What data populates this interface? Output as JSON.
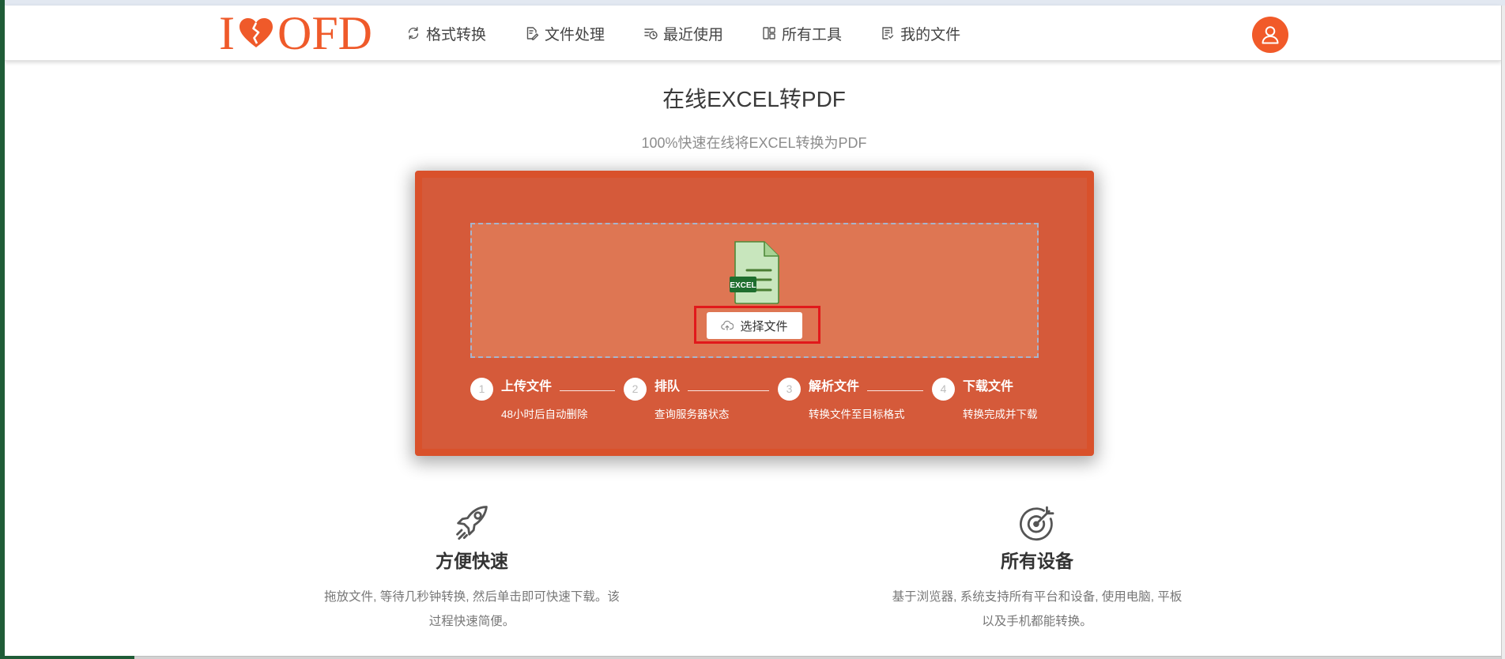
{
  "header": {
    "logo": {
      "text_left": "I",
      "text_right": "OFD",
      "icon": "broken-heart-icon"
    },
    "nav": [
      {
        "label": "格式转换",
        "icon": "convert-icon"
      },
      {
        "label": "文件处理",
        "icon": "file-edit-icon"
      },
      {
        "label": "最近使用",
        "icon": "recent-clock-icon"
      },
      {
        "label": "所有工具",
        "icon": "tools-grid-icon"
      },
      {
        "label": "我的文件",
        "icon": "my-files-icon"
      }
    ],
    "avatar_icon": "user-icon"
  },
  "hero": {
    "title": "在线EXCEL转PDF",
    "subtitle": "100%快速在线将EXCEL转换为PDF"
  },
  "upload": {
    "file_icon": "excel-file-icon",
    "file_type_label": "EXCEL",
    "button_icon": "cloud-upload-icon",
    "button_label": "选择文件",
    "steps": [
      {
        "number": "1",
        "title": "上传文件",
        "desc": "48小时后自动删除"
      },
      {
        "number": "2",
        "title": "排队",
        "desc": "查询服务器状态"
      },
      {
        "number": "3",
        "title": "解析文件",
        "desc": "转换文件至目标格式"
      },
      {
        "number": "4",
        "title": "下载文件",
        "desc": "转换完成并下载"
      }
    ]
  },
  "features": [
    {
      "icon": "rocket-icon",
      "title": "方便快速",
      "desc_lines": [
        "拖放文件, 等待几秒钟转换, 然后单击即可快速下载。该",
        "过程快速简便。"
      ]
    },
    {
      "icon": "target-icon",
      "title": "所有设备",
      "desc_lines": [
        "基于浏览器, 系统支持所有平台和设备, 使用电脑, 平板",
        "以及手机都能转换。"
      ]
    }
  ],
  "colors": {
    "brand": "#ef5a2a",
    "panel": "#d55a3a",
    "panel_border": "#d9512b",
    "dropzone": "#de7653",
    "highlight": "#e1191b",
    "excel_green": "#1e6e2e"
  }
}
